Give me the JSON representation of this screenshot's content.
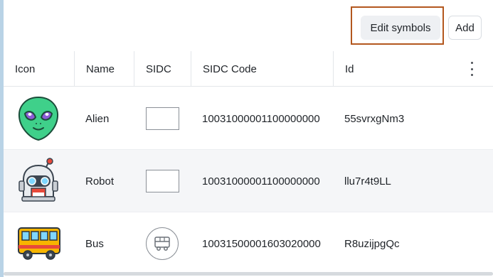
{
  "toolbar": {
    "edit_symbols_label": "Edit symbols",
    "add_label": "Add"
  },
  "table": {
    "columns": [
      "Icon",
      "Name",
      "SIDC",
      "SIDC Code",
      "Id"
    ],
    "rows": [
      {
        "icon": "alien-icon",
        "name": "Alien",
        "sidc_shape": "rectangle",
        "sidc_code": "10031000001100000000",
        "id": "55svrxgNm3"
      },
      {
        "icon": "robot-icon",
        "name": "Robot",
        "sidc_shape": "rectangle",
        "sidc_code": "10031000001100000000",
        "id": "llu7r4t9LL"
      },
      {
        "icon": "bus-icon",
        "name": "Bus",
        "sidc_shape": "circle-bus",
        "sidc_code": "10031500001603020000",
        "id": "R8uzijpgQc"
      }
    ]
  },
  "colors": {
    "highlight": "#b3571e",
    "alien_green": "#3fd08a",
    "bus_yellow": "#f7b500"
  }
}
